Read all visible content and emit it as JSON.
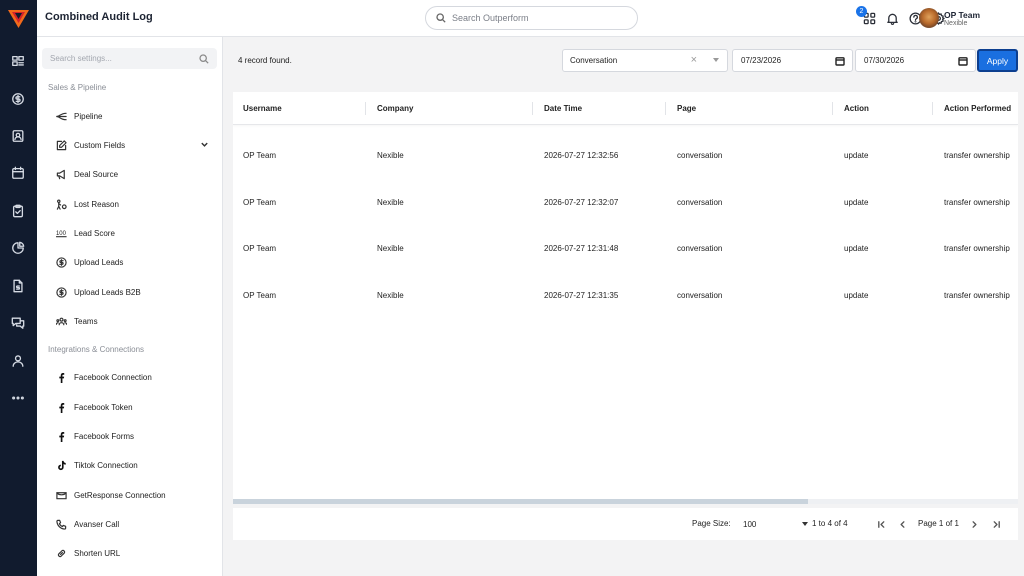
{
  "app": {
    "title": "Combined Audit Log"
  },
  "header": {
    "search_placeholder": "Search Outperform",
    "notification_count": "2",
    "user_name": "OP Team",
    "user_company": "Nexible"
  },
  "settings": {
    "search_placeholder": "Search settings...",
    "section_sales": "Sales & Pipeline",
    "section_integrations": "Integrations & Connections",
    "items": [
      {
        "label": "Pipeline",
        "icon": "pipeline-icon"
      },
      {
        "label": "Custom Fields",
        "icon": "edit-icon"
      },
      {
        "label": "Deal Source",
        "icon": "megaphone-icon"
      },
      {
        "label": "Lost Reason",
        "icon": "lost-reason-icon"
      },
      {
        "label": "Lead Score",
        "icon": "lead-score-icon"
      },
      {
        "label": "Upload Leads",
        "icon": "dollar-circle-icon"
      },
      {
        "label": "Upload Leads B2B",
        "icon": "dollar-circle-icon"
      },
      {
        "label": "Teams",
        "icon": "teams-icon"
      },
      {
        "label": "Facebook Connection",
        "icon": "facebook-icon"
      },
      {
        "label": "Facebook Token",
        "icon": "facebook-icon"
      },
      {
        "label": "Facebook Forms",
        "icon": "facebook-icon"
      },
      {
        "label": "Tiktok Connection",
        "icon": "tiktok-icon"
      },
      {
        "label": "GetResponse Connection",
        "icon": "getresponse-icon"
      },
      {
        "label": "Avanser Call",
        "icon": "phone-icon"
      },
      {
        "label": "Shorten URL",
        "icon": "link-icon"
      }
    ]
  },
  "filters": {
    "record_count": "4 record found.",
    "page_filter": "Conversation",
    "date_from": "07/23/2026",
    "date_to": "07/30/2026",
    "apply_label": "Apply"
  },
  "table": {
    "columns": [
      "Username",
      "Company",
      "Date Time",
      "Page",
      "Action",
      "Action Performed"
    ],
    "rows": [
      [
        "OP Team",
        "Nexible",
        "2026-07-27 12:32:56",
        "conversation",
        "update",
        "transfer ownership"
      ],
      [
        "OP Team",
        "Nexible",
        "2026-07-27 12:32:07",
        "conversation",
        "update",
        "transfer ownership"
      ],
      [
        "OP Team",
        "Nexible",
        "2026-07-27 12:31:48",
        "conversation",
        "update",
        "transfer ownership"
      ],
      [
        "OP Team",
        "Nexible",
        "2026-07-27 12:31:35",
        "conversation",
        "update",
        "transfer ownership"
      ]
    ]
  },
  "pagination": {
    "page_size_label": "Page Size:",
    "page_size": "100",
    "range": "1 to 4 of 4",
    "page_info": "Page 1 of 1"
  },
  "colors": {
    "rail_bg": "#111b2e",
    "accent": "#1a6fe0",
    "logo_orange": "#f26a1b",
    "logo_red": "#d4232b"
  }
}
